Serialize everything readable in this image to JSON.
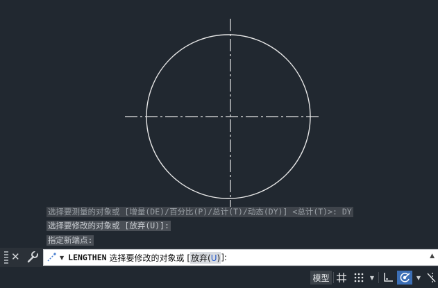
{
  "history": [
    "选择要测量的对象或 [增量(DE)/百分比(P)/总计(T)/动态(DY)] <总计(T)>: DY",
    "选择要修改的对象或 [放弃(U)]:",
    "指定新端点:"
  ],
  "command_line": {
    "command": "LENGTHEN",
    "prompt_prefix": "选择要修改的对象或 [",
    "option_label": "放弃(",
    "option_key": "U",
    "option_close": ")",
    "prompt_suffix": "]:"
  },
  "statusbar": {
    "model_label": "模型"
  },
  "colors": {
    "background": "#212830",
    "drawing": "#e6e6e6",
    "accent": "#3c6fb6"
  },
  "icons": {
    "close": "close-icon",
    "customize": "wrench-icon",
    "command": "command-line-icon",
    "grid": "grid-icon",
    "snap": "snap-icon",
    "ortho": "ortho-icon",
    "polar": "polar-tracking-icon",
    "osnap": "object-snap-icon"
  }
}
